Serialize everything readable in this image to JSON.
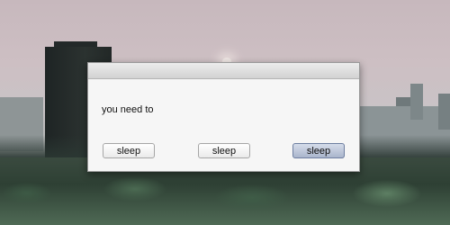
{
  "dialog": {
    "message": "you need to",
    "buttons": [
      {
        "label": "sleep"
      },
      {
        "label": "sleep"
      },
      {
        "label": "sleep"
      }
    ]
  }
}
